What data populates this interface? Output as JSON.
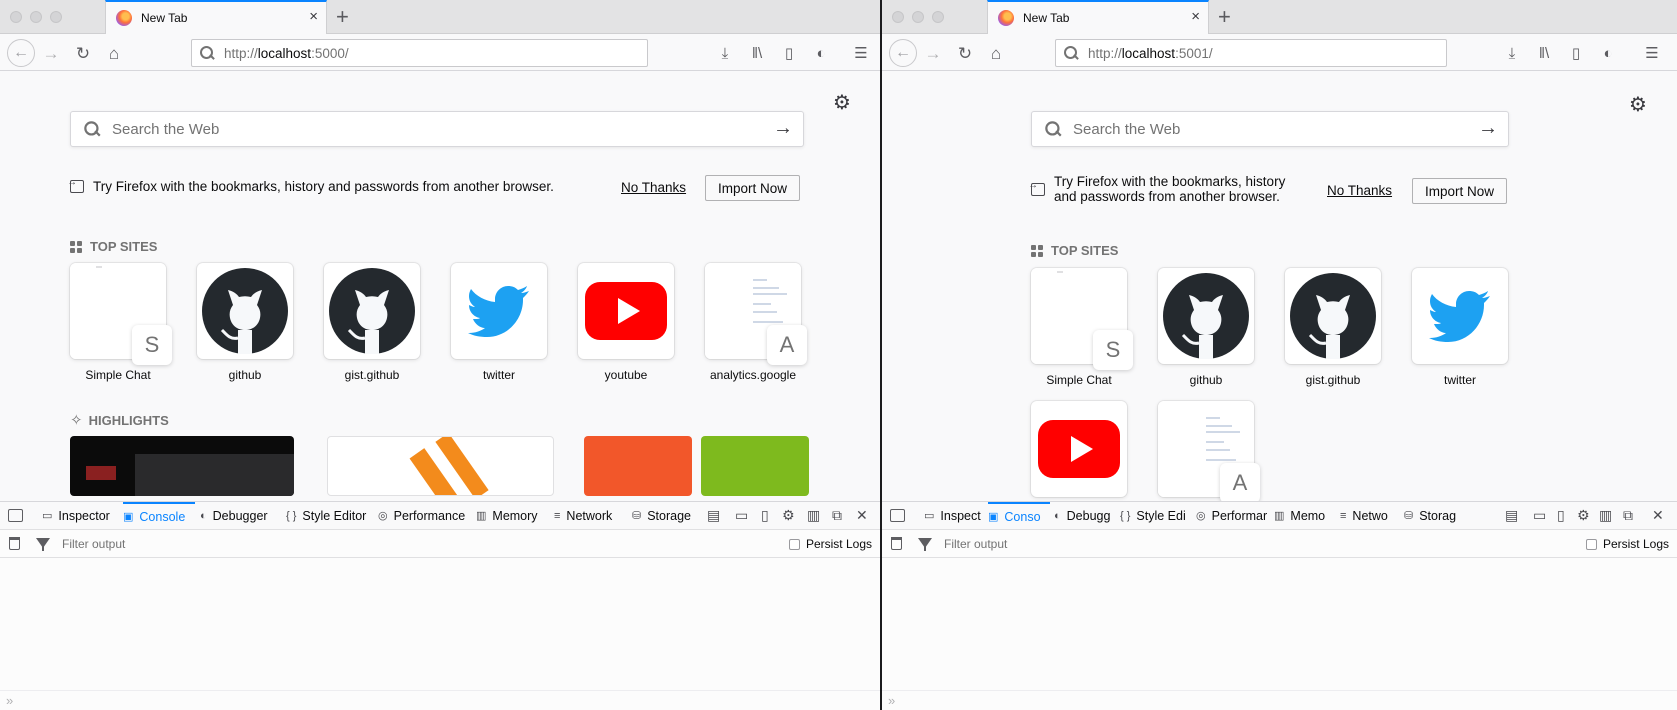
{
  "left": {
    "tab": {
      "title": "New Tab"
    },
    "url": {
      "prefix": "http://",
      "host": "localhost",
      "suffix": ":5000/"
    },
    "search": {
      "placeholder": "Search the Web"
    },
    "import": {
      "message": "Try Firefox with the bookmarks, history and passwords from another browser.",
      "no_thanks": "No Thanks",
      "import_now": "Import Now"
    },
    "sections": {
      "top_sites": "TOP SITES",
      "highlights": "HIGHLIGHTS"
    },
    "top_sites": [
      {
        "label": "Simple Chat",
        "kind": "letter",
        "letter": "S"
      },
      {
        "label": "github",
        "kind": "github"
      },
      {
        "label": "gist.github",
        "kind": "github"
      },
      {
        "label": "twitter",
        "kind": "twitter"
      },
      {
        "label": "youtube",
        "kind": "youtube"
      },
      {
        "label": "analytics.google",
        "kind": "letter-page",
        "letter": "A"
      }
    ],
    "devtools": {
      "tabs": [
        "Inspector",
        "Console",
        "Debugger",
        "Style Editor",
        "Performance",
        "Memory",
        "Network",
        "Storage"
      ],
      "selected": "Console",
      "filter_placeholder": "Filter output",
      "persist_logs": "Persist Logs"
    }
  },
  "right": {
    "tab": {
      "title": "New Tab"
    },
    "url": {
      "prefix": "http://",
      "host": "localhost",
      "suffix": ":5001/"
    },
    "search": {
      "placeholder": "Search the Web"
    },
    "import": {
      "message": "Try Firefox with the bookmarks, history and passwords from another browser.",
      "no_thanks": "No Thanks",
      "import_now": "Import Now"
    },
    "sections": {
      "top_sites": "TOP SITES"
    },
    "top_sites": [
      {
        "label": "Simple Chat",
        "kind": "letter",
        "letter": "S"
      },
      {
        "label": "github",
        "kind": "github"
      },
      {
        "label": "gist.github",
        "kind": "github"
      },
      {
        "label": "twitter",
        "kind": "twitter"
      },
      {
        "label": "",
        "kind": "youtube"
      },
      {
        "label": "",
        "kind": "letter-page",
        "letter": "A"
      }
    ],
    "devtools": {
      "tabs": [
        "Inspect",
        "Conso",
        "Debugg",
        "Style Edi",
        "Performar",
        "Memo",
        "Netwo",
        "Storag"
      ],
      "selected": "Conso",
      "filter_placeholder": "Filter output",
      "persist_logs": "Persist Logs"
    }
  },
  "icons": {
    "tab_close": "×",
    "new_tab": "+",
    "back": "←",
    "forward": "→",
    "reload": "↻",
    "home": "⌂",
    "download": "⤓",
    "library": "‖\\",
    "sidebar": "▯",
    "shield": "◐",
    "menu": "☰",
    "gear": "⚙",
    "search_go": "→",
    "highlights": "✧",
    "close_devtools": "✕",
    "prompt": "»"
  }
}
